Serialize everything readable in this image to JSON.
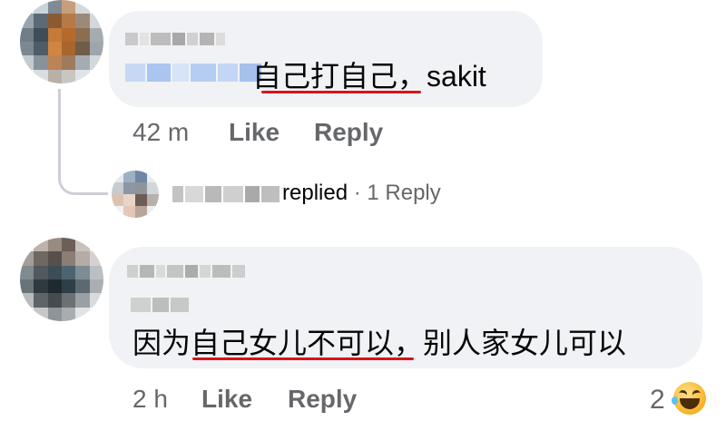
{
  "comments": [
    {
      "text_prefix": "",
      "text_main": "自己打自己",
      "text_suffix": "，sakit",
      "time": "42 m",
      "like_label": "Like",
      "reply_label": "Reply"
    },
    {
      "second_line_a": "因为",
      "second_line_b": "自己女儿不可以",
      "second_line_c": "，别人家女儿可以",
      "time": "2 h",
      "like_label": "Like",
      "reply_label": "Reply",
      "reaction_count": "2",
      "reaction_icon": "laughing-emoji-icon"
    }
  ],
  "reply_summary": {
    "replied": "replied",
    "separator": "·",
    "count": "1 Reply"
  },
  "colors": {
    "bubble": "#f0f2f5",
    "underline": "#d9121d",
    "meta": "#65676b",
    "thread_line": "#ccd0d5"
  }
}
